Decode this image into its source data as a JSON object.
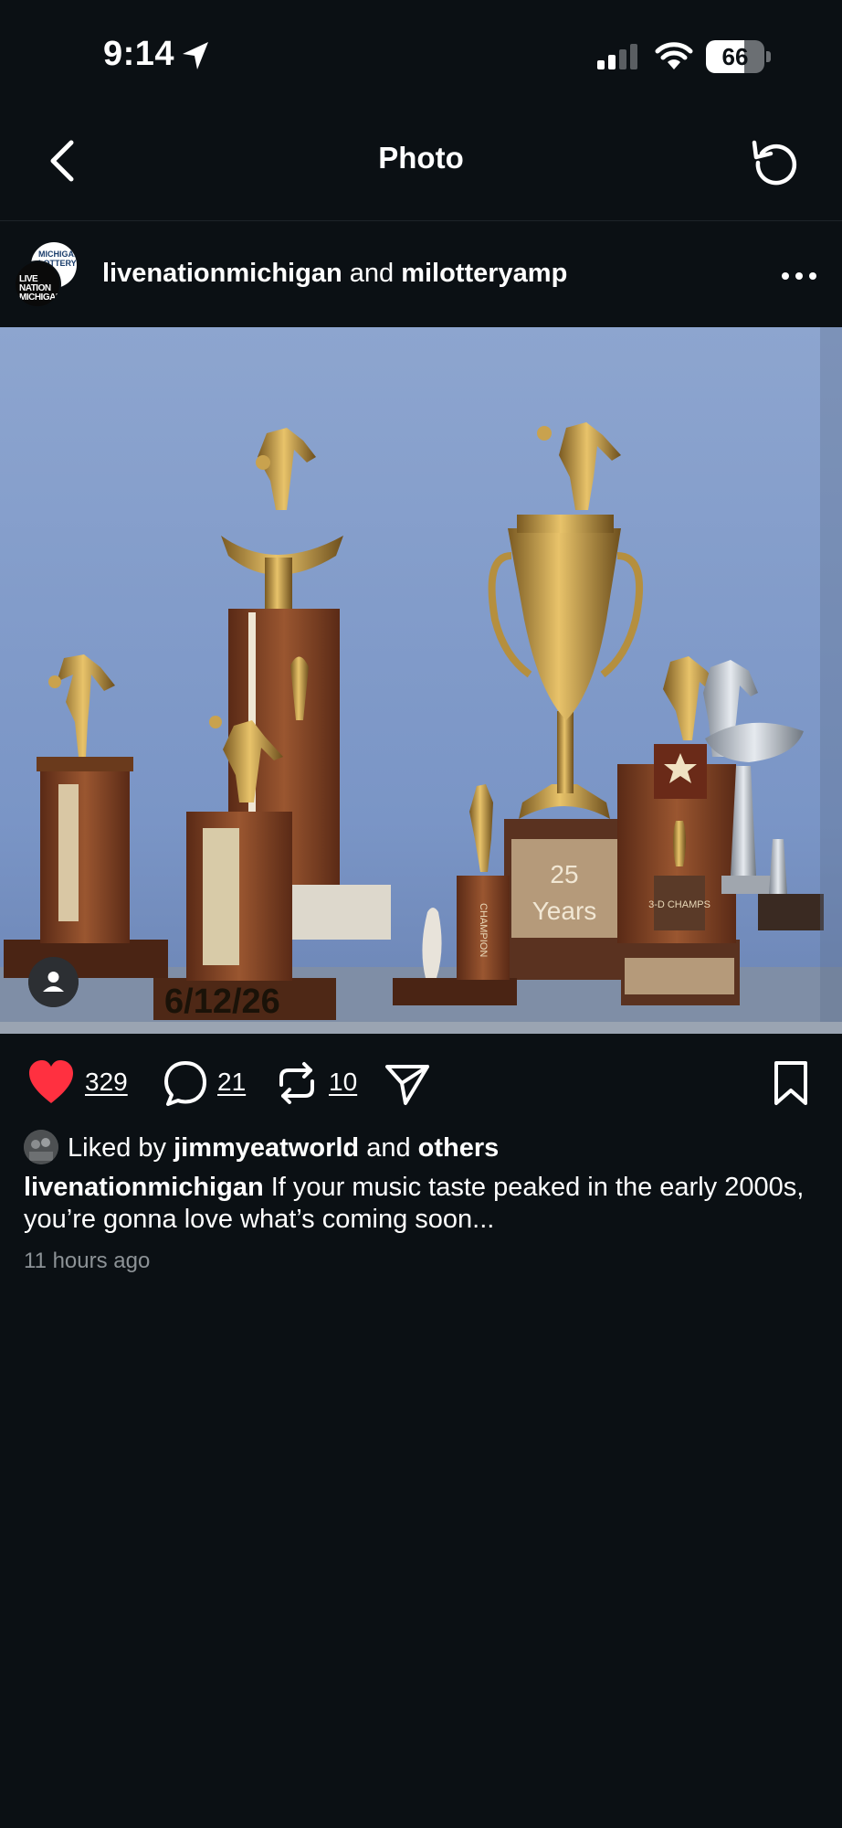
{
  "status_bar": {
    "time": "9:14",
    "battery_percent": "66",
    "battery_level": 0.66
  },
  "nav": {
    "title": "Photo"
  },
  "post": {
    "author1": "livenationmichigan",
    "and_word": "and",
    "author2": "milotteryamp",
    "avatar_back_text": "MICHIGAN LOTTERY",
    "avatar_front_text": "LIVE NATION MICHIGAN",
    "photo": {
      "date_text": "6/12/26",
      "plaque_line1": "25",
      "plaque_line2": "Years",
      "champion_text": "CHAMPION",
      "small_plaque_text": "3-D CHAMPS"
    },
    "likes_count": "329",
    "comments_count": "21",
    "reposts_count": "10",
    "liked_by_prefix": "Liked by",
    "liked_by_user": "jimmyeatworld",
    "liked_by_and": "and",
    "liked_by_others": "others",
    "caption_author": "livenationmichigan",
    "caption_text": "If your music taste peaked in the early 2000s, you’re gonna love what’s coming soon...",
    "timestamp": "11 hours ago"
  },
  "icons": {
    "location": "location-arrow-icon",
    "signal": "cellular-signal-icon",
    "wifi": "wifi-icon",
    "battery": "battery-icon",
    "back": "chevron-left-icon",
    "refresh": "refresh-icon",
    "more": "more-horizontal-icon",
    "tag": "person-tag-icon",
    "like": "heart-icon",
    "comment": "comment-bubble-icon",
    "repost": "repost-icon",
    "share": "send-icon",
    "save": "bookmark-icon"
  },
  "colors": {
    "background": "#0b1014",
    "like_red": "#ff3040",
    "photo_wall": "#8ea4cc",
    "secondary_text": "#8c9296"
  }
}
